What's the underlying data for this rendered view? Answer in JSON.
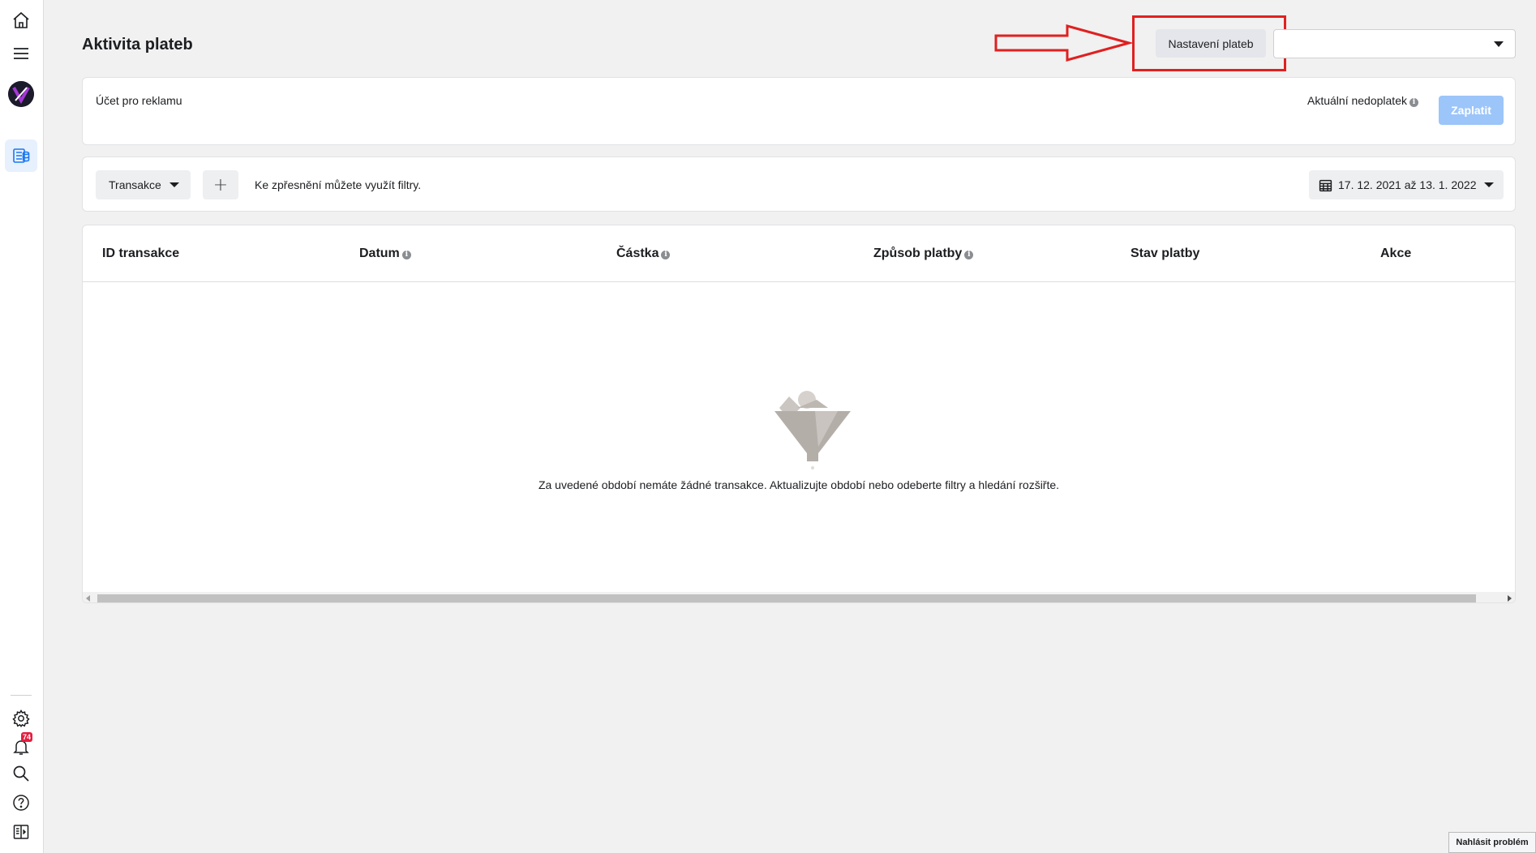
{
  "sidebar": {
    "items": [
      {
        "name": "home-icon"
      },
      {
        "name": "menu-icon"
      },
      {
        "name": "account-avatar"
      },
      {
        "name": "billing-icon"
      },
      {
        "name": "gear-icon"
      },
      {
        "name": "bell-icon"
      },
      {
        "name": "search-icon"
      },
      {
        "name": "help-icon"
      },
      {
        "name": "panel-toggle-icon"
      }
    ],
    "notification_count": "74"
  },
  "header": {
    "title": "Aktivita plateb",
    "settings_button": "Nastavení plateb",
    "account_select_value": ""
  },
  "account_card": {
    "account_label": "Účet pro reklamu",
    "overdue_label": "Aktuální nedoplatek",
    "pay_button": "Zaplatit"
  },
  "filters": {
    "type_dropdown": "Transakce",
    "add_filter": "+",
    "hint": "Ke zpřesnění můžete využít filtry.",
    "date_range": "17. 12. 2021 až 13. 1. 2022"
  },
  "table": {
    "columns": [
      "ID transakce",
      "Datum",
      "Částka",
      "Způsob platby",
      "Stav platby",
      "Akce"
    ],
    "rows": [],
    "empty_message": "Za uvedené období nemáte žádné transakce. Aktualizujte období nebo odeberte filtry a hledání rozšiřte."
  },
  "annotation": {
    "color": "#e02020"
  },
  "colors": {
    "accent_disabled": "#9cc5f9",
    "background": "#f1f1f1"
  },
  "report_problem": "Nahlásit problém"
}
